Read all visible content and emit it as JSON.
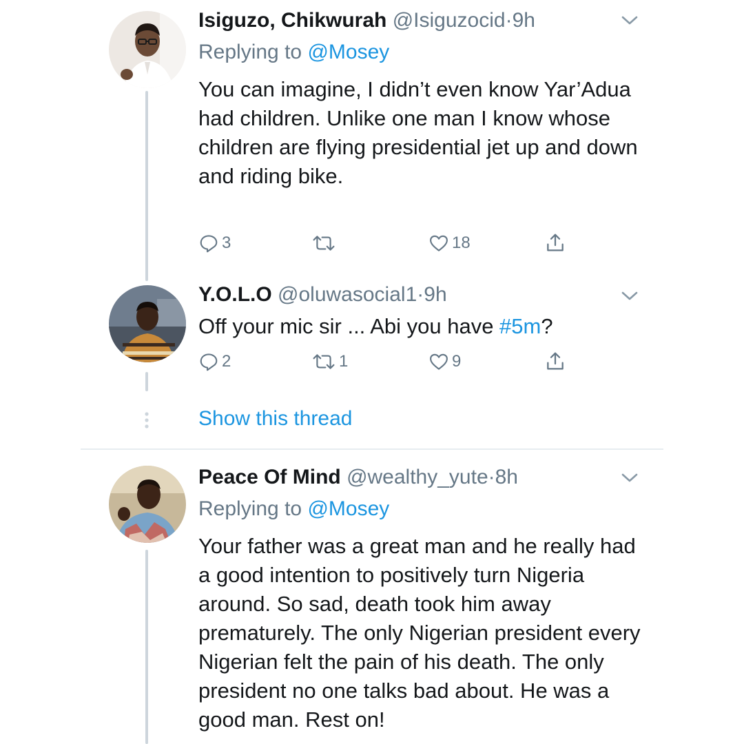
{
  "tweets": [
    {
      "name": "Isiguzo, Chikwurah",
      "handle": "@Isiguzocid",
      "separator": "·",
      "time": "9h",
      "replying_prefix": "Replying to",
      "replying_mention": "@Mosey",
      "text": "You can imagine, I didn’t even know Yar’Adua had children. Unlike one man I know whose children are flying presidential jet up and down and riding bike.",
      "replies": "3",
      "retweets": "",
      "likes": "18"
    },
    {
      "name": "Y.O.L.O",
      "handle": "@oluwasocial1",
      "separator": "·",
      "time": "9h",
      "text_before": "Off your mic sir ... Abi you have ",
      "hashtag": "#5m",
      "text_after": "?",
      "replies": "2",
      "retweets": "1",
      "likes": "9"
    },
    {
      "name": "Peace Of Mind",
      "handle": "@wealthy_yute",
      "separator": "·",
      "time": "8h",
      "replying_prefix": "Replying to",
      "replying_mention": "@Mosey",
      "text": "Your father was a great man and he really had a good intention to positively turn Nigeria around. So sad, death took him away prematurely. The only Nigerian president every Nigerian felt the pain of his death. The only president no one talks bad about. He was a good man. Rest on!"
    }
  ],
  "show_thread_label": "Show this thread",
  "icons": {
    "reply": "reply-icon",
    "retweet": "retweet-icon",
    "like": "heart-icon",
    "share": "share-icon",
    "caret": "chevron-down-icon"
  },
  "colors": {
    "accent": "#1b95e0",
    "secondary_text": "#657786",
    "thread_line": "#cdd5dc"
  }
}
